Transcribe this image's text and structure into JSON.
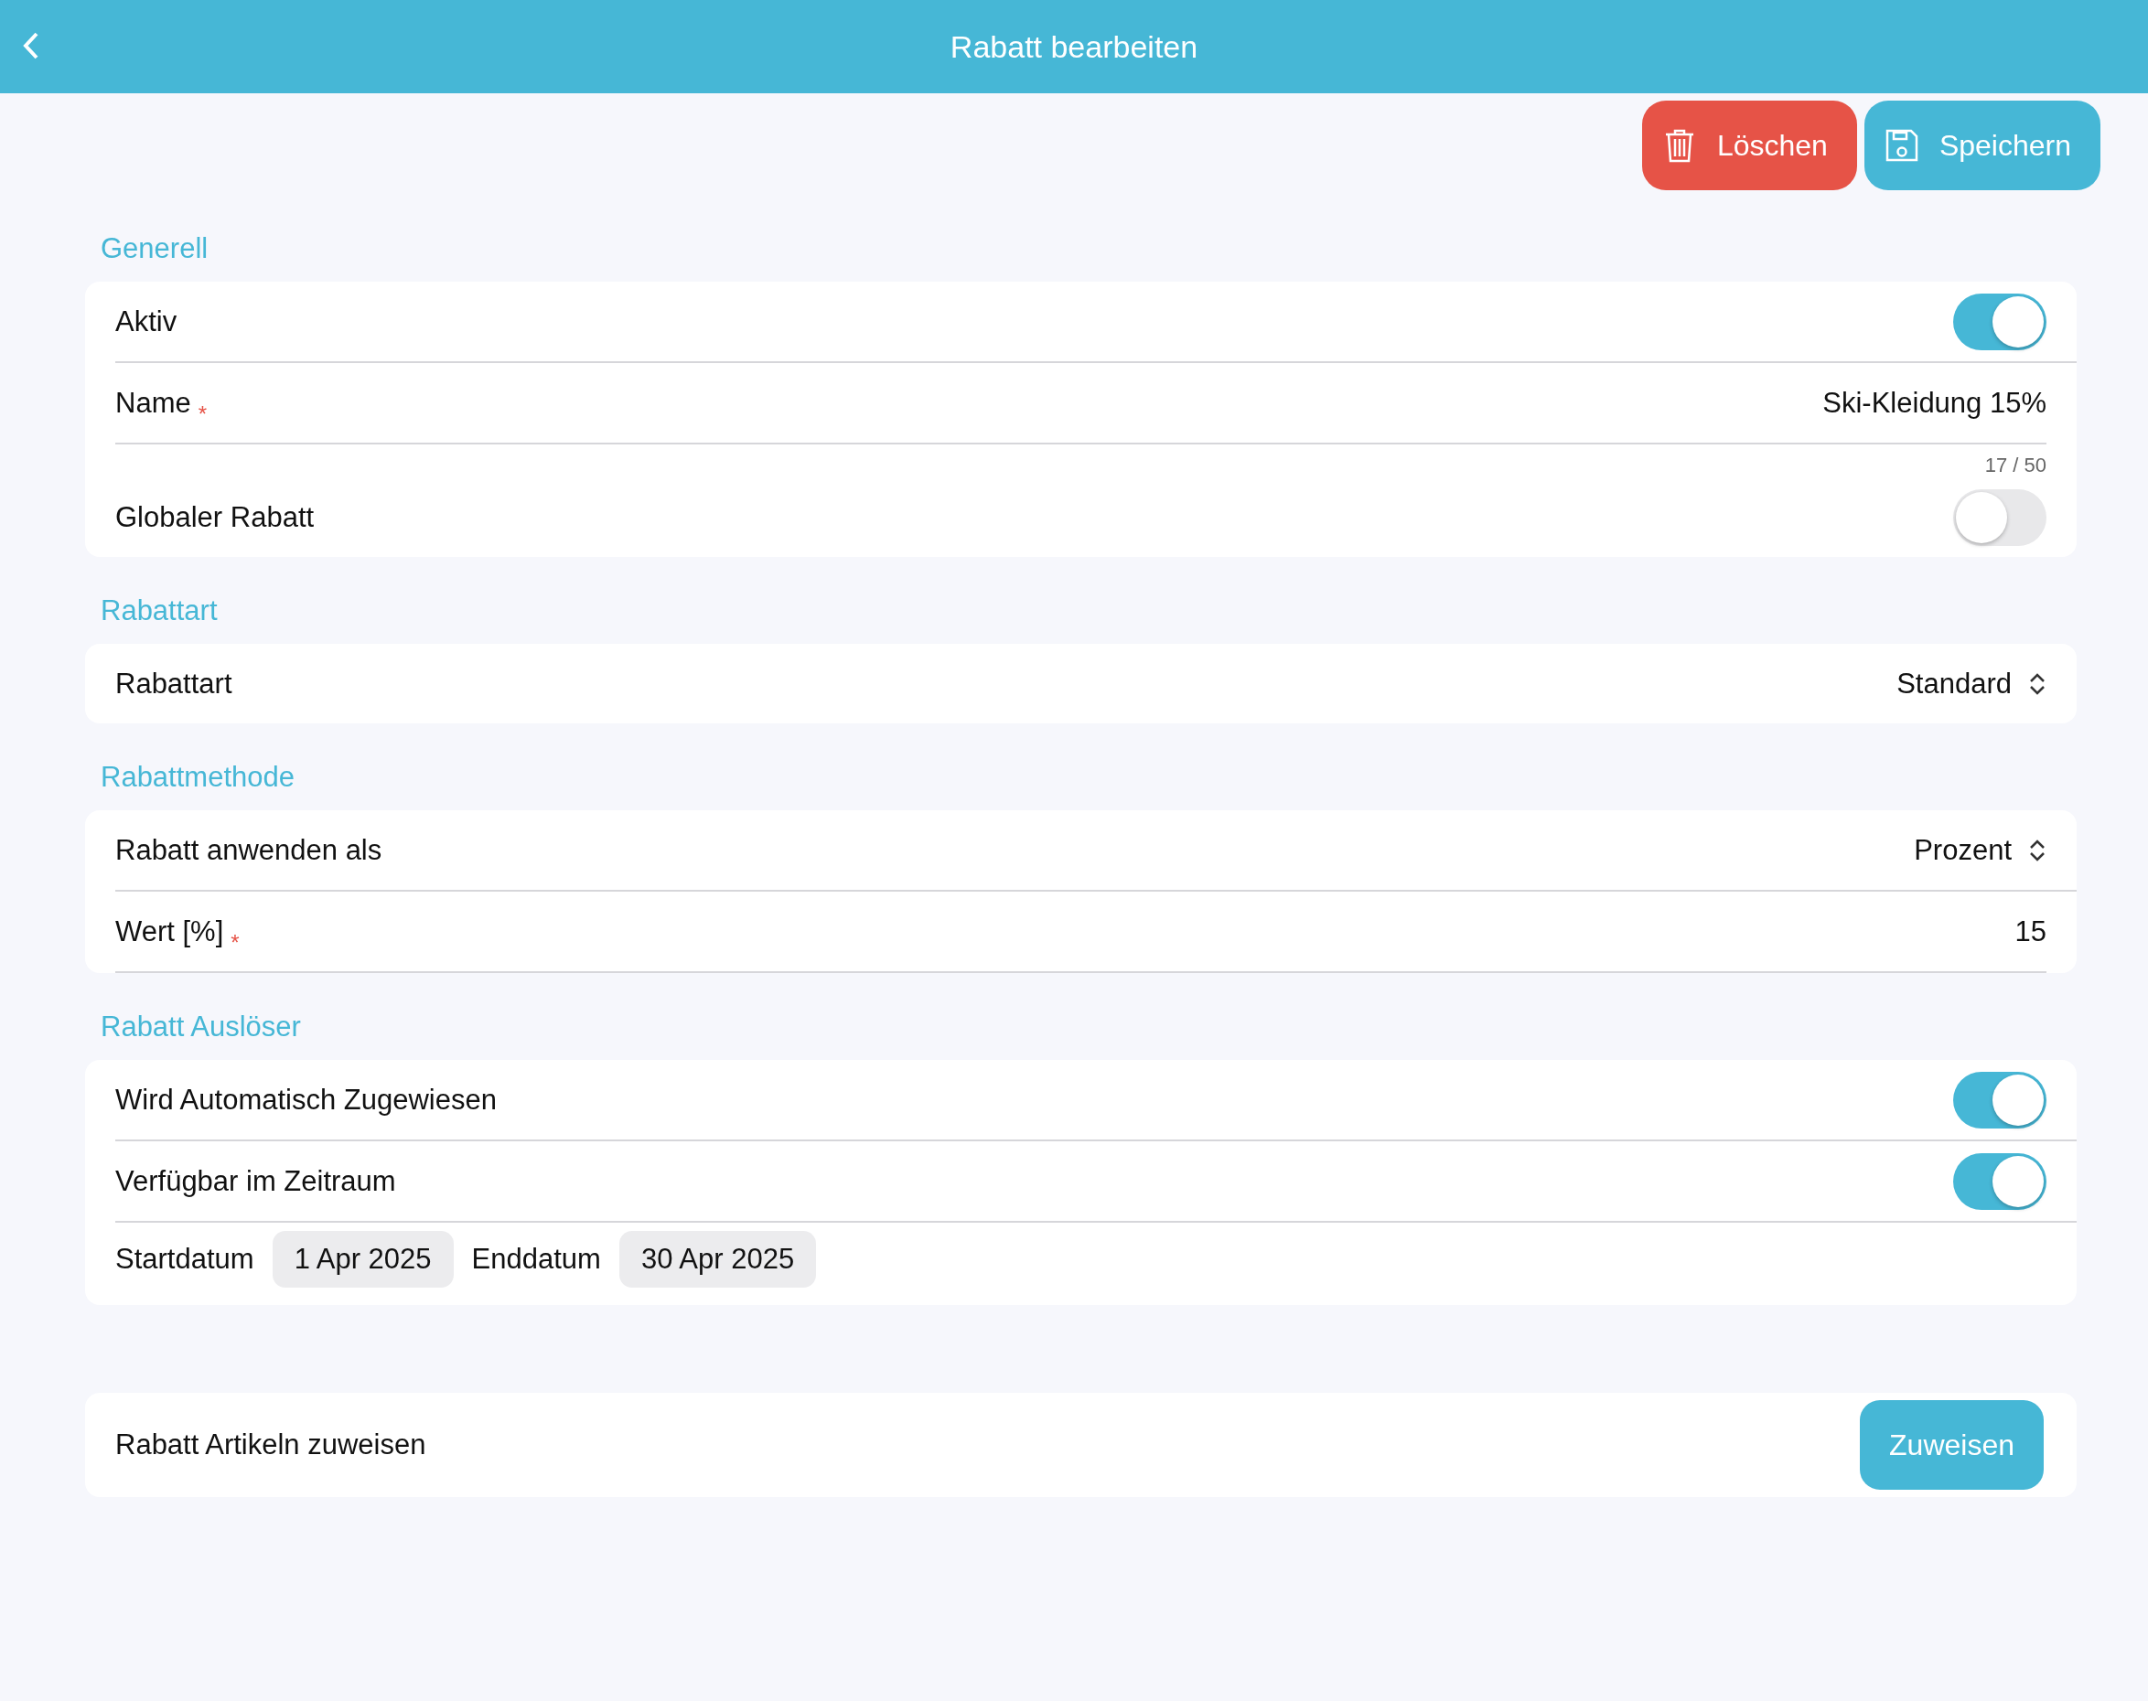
{
  "header": {
    "title": "Rabatt bearbeiten"
  },
  "actions": [
    {
      "kind": "delete",
      "label": "Löschen"
    },
    {
      "kind": "save",
      "label": "Speichern"
    }
  ],
  "sections": [
    {
      "title": "Generell",
      "rows": [
        {
          "kind": "toggle",
          "label": "Aktiv",
          "on": true
        },
        {
          "kind": "text",
          "label": "Name",
          "required_mark": "*",
          "value": "Ski-Kleidung 15%",
          "counter": "17 / 50"
        },
        {
          "kind": "toggle",
          "label": "Globaler Rabatt",
          "on": false
        }
      ]
    },
    {
      "title": "Rabattart",
      "rows": [
        {
          "kind": "select",
          "label": "Rabattart",
          "value": "Standard"
        }
      ]
    },
    {
      "title": "Rabattmethode",
      "rows": [
        {
          "kind": "select",
          "label": "Rabatt anwenden als",
          "value": "Prozent"
        },
        {
          "kind": "text",
          "label": "Wert [%]",
          "required_mark": "*",
          "value": "15"
        }
      ]
    },
    {
      "title": "Rabatt Auslöser",
      "rows": [
        {
          "kind": "toggle",
          "label": "Wird Automatisch Zugewiesen",
          "on": true
        },
        {
          "kind": "toggle",
          "label": "Verfügbar im Zeitraum",
          "on": true
        },
        {
          "kind": "dates",
          "dates": [
            {
              "label": "Startdatum",
              "value": "1 Apr 2025"
            },
            {
              "label": "Enddatum",
              "value": "30 Apr 2025"
            }
          ]
        }
      ]
    }
  ],
  "assign": {
    "label": "Rabatt Artikeln zuweisen",
    "button": "Zuweisen"
  }
}
